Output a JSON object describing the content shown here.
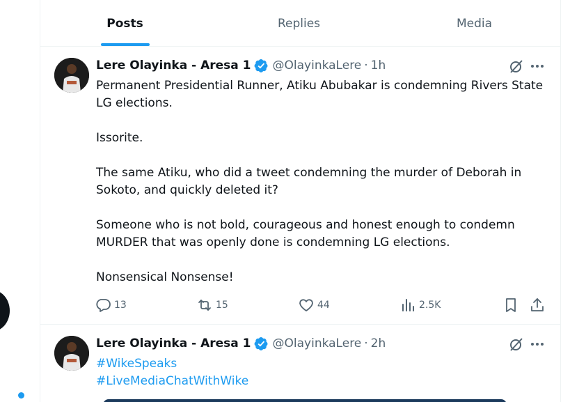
{
  "tabs": [
    {
      "label": "Posts",
      "active": true
    },
    {
      "label": "Replies",
      "active": false
    },
    {
      "label": "Media",
      "active": false
    }
  ],
  "tweets": [
    {
      "display_name": "Lere Olayinka - Aresa 1",
      "handle": "@OlayinkaLere",
      "separator": "·",
      "time": "1h",
      "verified": true,
      "paragraphs": [
        "Permanent Presidential Runner, Atiku Abubakar is condemning Rivers State LG elections.",
        "Issorite.",
        "The same Atiku, who did a tweet condemning the murder of Deborah in Sokoto, and quickly deleted it?",
        "Someone who is not bold, courageous and honest enough to condemn MURDER that was openly done is condemning LG elections.",
        "Nonsensical Nonsense!"
      ],
      "stats": {
        "replies": "13",
        "reposts": "15",
        "likes": "44",
        "views": "2.5K"
      }
    },
    {
      "display_name": "Lere Olayinka - Aresa 1",
      "handle": "@OlayinkaLere",
      "separator": "·",
      "time": "2h",
      "verified": true,
      "hashtags": [
        "#WikeSpeaks",
        "#LiveMediaChatWithWike"
      ]
    }
  ],
  "colors": {
    "accent": "#1d9bf0",
    "text_primary": "#0f1419",
    "text_secondary": "#536471",
    "border": "#eff3f4"
  },
  "icons": {
    "verified": "verified-badge-icon",
    "grok": "grok-icon",
    "more": "more-icon",
    "reply": "reply-icon",
    "repost": "repost-icon",
    "like": "heart-icon",
    "views": "views-icon",
    "bookmark": "bookmark-icon",
    "share": "share-icon"
  }
}
